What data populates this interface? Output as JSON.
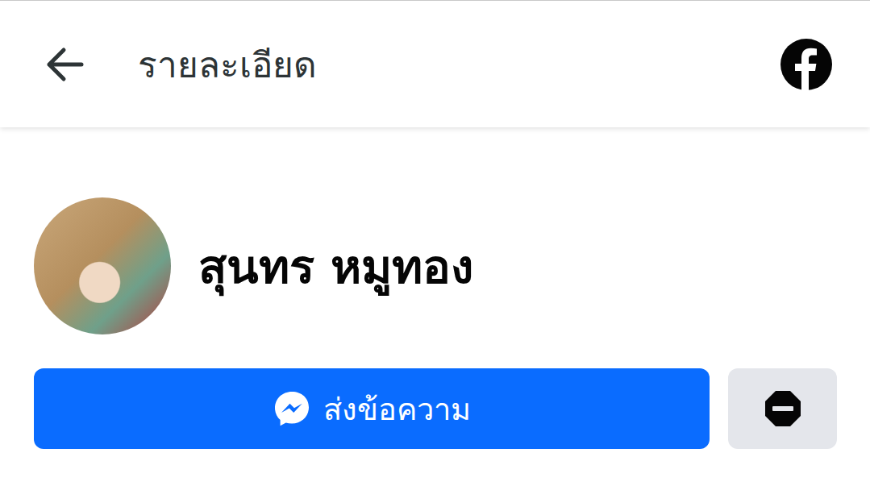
{
  "header": {
    "title": "รายละเอียด"
  },
  "profile": {
    "name": "สุนทร หมูทอง"
  },
  "actions": {
    "message_button": "ส่งข้อความ"
  }
}
